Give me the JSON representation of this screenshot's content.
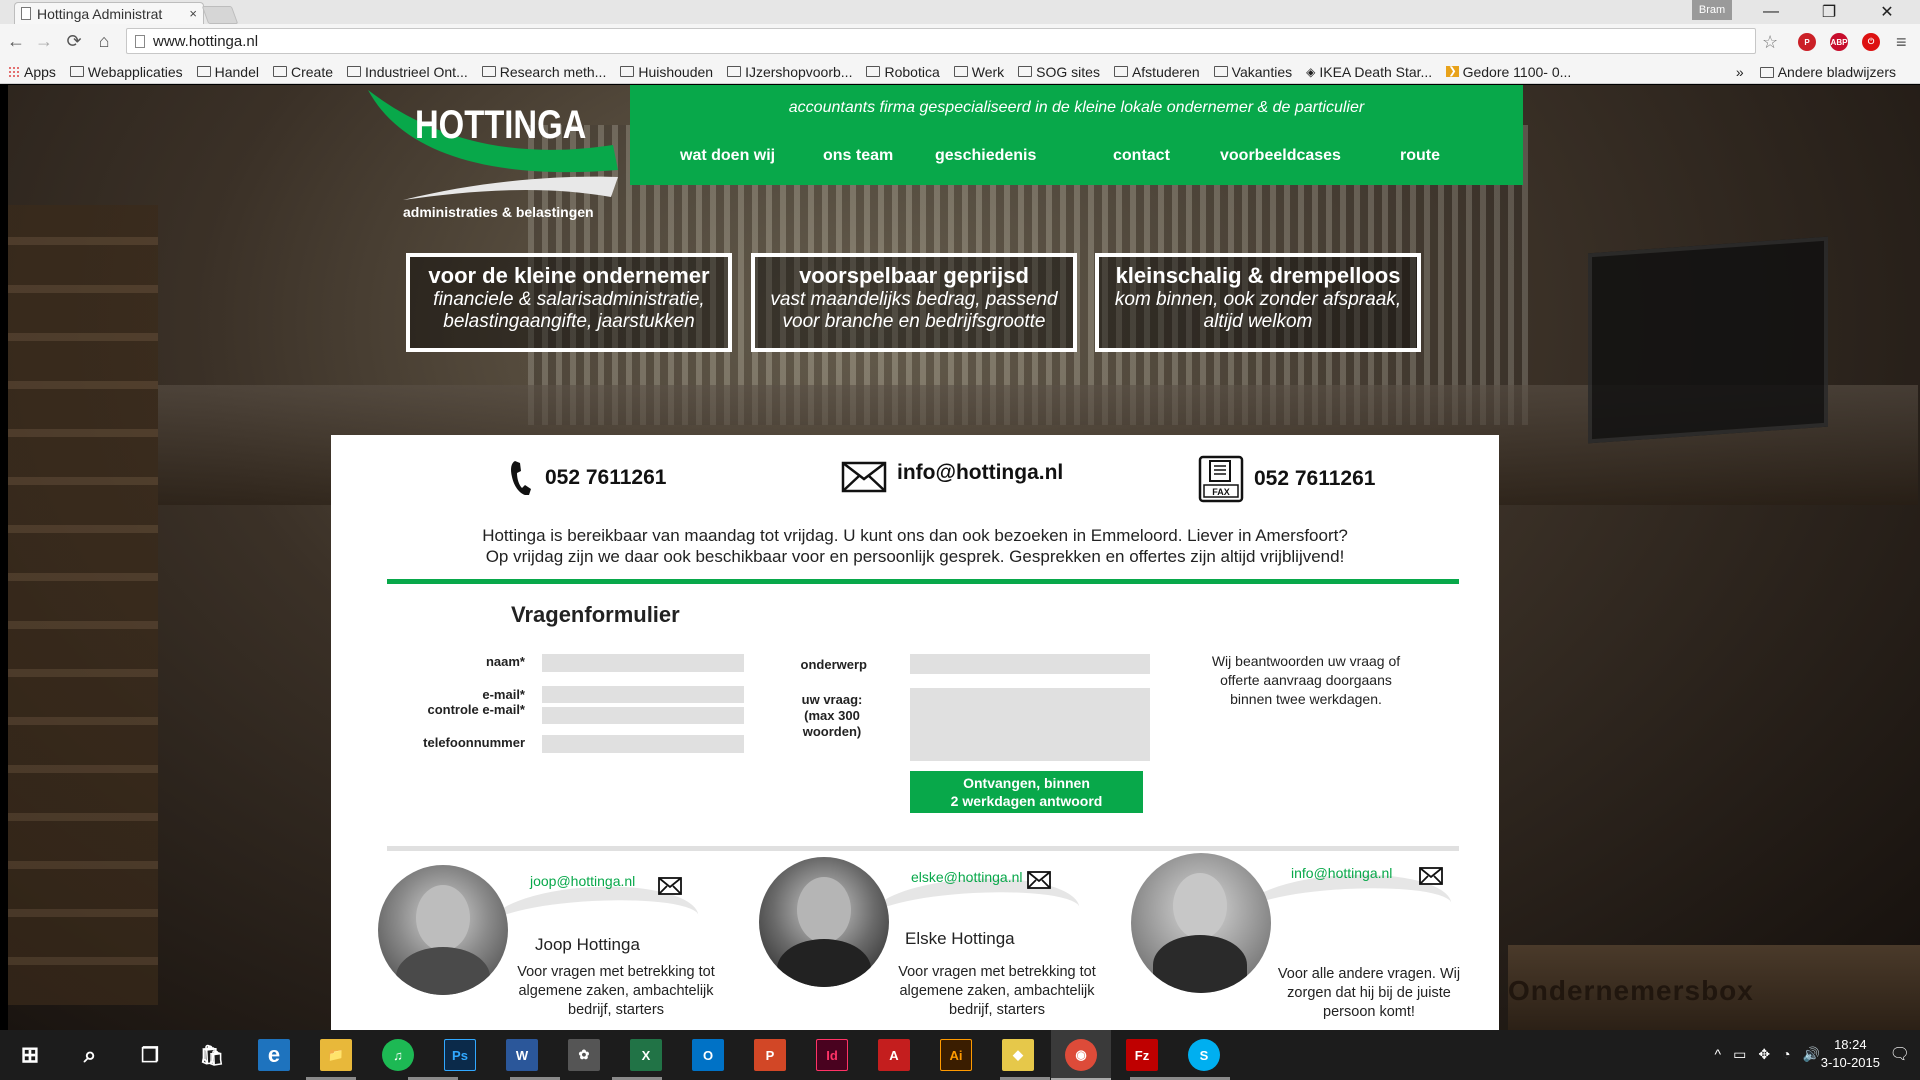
{
  "browser": {
    "tab_title": "Hottinga Administrat",
    "tab_close": "×",
    "profile": "Bram",
    "url": "www.hottinga.nl",
    "window_buttons": {
      "minimize": "—",
      "restore": "❐",
      "close": "✕"
    },
    "nav": {
      "back": "←",
      "forward": "→",
      "reload": "⟳",
      "home": "⌂"
    },
    "star": "☆",
    "menu": "≡",
    "extensions": [
      {
        "label": "P",
        "color": "#cb2027"
      },
      {
        "label": "ABP",
        "color": "#c70d2c"
      },
      {
        "label": "⏻",
        "color": "#d11"
      }
    ]
  },
  "bookmarks": {
    "items": [
      {
        "label": "Apps",
        "icon": "apps-grid-icon"
      },
      {
        "label": "Webapplicaties",
        "icon": "folder-icon"
      },
      {
        "label": "Handel",
        "icon": "folder-icon"
      },
      {
        "label": "Create",
        "icon": "folder-icon"
      },
      {
        "label": "Industrieel Ont...",
        "icon": "folder-icon"
      },
      {
        "label": "Research meth...",
        "icon": "folder-icon"
      },
      {
        "label": "Huishouden",
        "icon": "folder-icon"
      },
      {
        "label": "IJzershopvoorb...",
        "icon": "folder-icon"
      },
      {
        "label": "Robotica",
        "icon": "folder-icon"
      },
      {
        "label": "Werk",
        "icon": "folder-icon"
      },
      {
        "label": "SOG sites",
        "icon": "folder-icon"
      },
      {
        "label": "Afstuderen",
        "icon": "folder-icon"
      },
      {
        "label": "Vakanties",
        "icon": "folder-icon"
      },
      {
        "label": "IKEA Death Star...",
        "icon": "site-icon"
      },
      {
        "label": "Gedore 1100- 0...",
        "icon": "site-icon"
      }
    ],
    "overflow": "»",
    "other": "Andere bladwijzers"
  },
  "site": {
    "logo": {
      "name": "HOTTINGA",
      "subtitle": "administraties & belastingen"
    },
    "tagline": "accountants firma gespecialiseerd in de kleine lokale ondernemer & de particulier",
    "nav": [
      "wat doen wij",
      "ons team",
      "geschiedenis",
      "contact",
      "voorbeeldcases",
      "route"
    ],
    "features": [
      {
        "title": "voor de kleine ondernemer",
        "text": "financiele & salarisadministratie, belastingaangifte, jaarstukken"
      },
      {
        "title": "voorspelbaar geprijsd",
        "text": "vast maandelijks bedrag, passend voor branche en bedrijfsgrootte"
      },
      {
        "title": "kleinschalig & drempelloos",
        "text": "kom binnen, ook zonder afspraak, altijd welkom"
      }
    ],
    "contact": {
      "phone": "052 7611261",
      "email": "info@hottinga.nl",
      "fax": "052 7611261",
      "fax_label": "FAX"
    },
    "info_line1": "Hottinga is bereikbaar van maandag tot vrijdag. U kunt ons dan ook bezoeken in Emmeloord. Liever in Amersfoort?",
    "info_line2": "Op vrijdag zijn we daar ook beschikbaar voor en persoonlijk gesprek. Gesprekken en offertes zijn altijd vrijblijvend!",
    "form": {
      "title": "Vragenformulier",
      "naam": "naam*",
      "email": "e-mail*",
      "controle_email": "controle e-mail*",
      "telefoon": "telefoonnummer",
      "onderwerp": "onderwerp",
      "vraag_1": "uw vraag:",
      "vraag_2": "(max 300",
      "vraag_3": "woorden)",
      "submit_1": "Ontvangen, binnen",
      "submit_2": "2 werkdagen antwoord",
      "reply_note": "Wij beantwoorden uw vraag of offerte aanvraag doorgaans binnen twee werkdagen."
    },
    "team": [
      {
        "email": "joop@hottinga.nl",
        "name": "Joop Hottinga",
        "desc": "Voor vragen met betrekking tot algemene zaken, ambachtelijk bedrijf, starters"
      },
      {
        "email": "elske@hottinga.nl",
        "name": "Elske Hottinga",
        "desc": "Voor vragen met betrekking tot algemene zaken, ambachtelijk bedrijf, starters"
      },
      {
        "email": "info@hottinga.nl",
        "name": "",
        "desc": "Voor alle andere vragen. Wij zorgen dat hij bij de juiste persoon komt!"
      }
    ],
    "background_text": "Ondernemersbox"
  },
  "taskbar": {
    "apps": [
      {
        "name": "start",
        "label": "⊞",
        "color": "transparent"
      },
      {
        "name": "search",
        "label": "⌕",
        "color": "transparent"
      },
      {
        "name": "task-view",
        "label": "❐",
        "color": "transparent"
      },
      {
        "name": "store",
        "label": "🛍",
        "color": "transparent"
      },
      {
        "name": "edge",
        "label": "e",
        "color": "#1e73be"
      },
      {
        "name": "file-explorer",
        "label": "📁",
        "color": "#e8b83a"
      },
      {
        "name": "spotify",
        "label": "♫",
        "color": "#1db954"
      },
      {
        "name": "photoshop",
        "label": "Ps",
        "color": "#0b2a4a"
      },
      {
        "name": "word",
        "label": "W",
        "color": "#2b579a"
      },
      {
        "name": "app-9",
        "label": "✿",
        "color": "#555"
      },
      {
        "name": "excel",
        "label": "X",
        "color": "#217346"
      },
      {
        "name": "outlook",
        "label": "O",
        "color": "#0072c6"
      },
      {
        "name": "powerpoint",
        "label": "P",
        "color": "#d24726"
      },
      {
        "name": "indesign",
        "label": "Id",
        "color": "#49021f"
      },
      {
        "name": "acrobat",
        "label": "A",
        "color": "#c41e1e"
      },
      {
        "name": "illustrator",
        "label": "Ai",
        "color": "#3a1d00"
      },
      {
        "name": "app-17",
        "label": "◆",
        "color": "#e6c84a"
      },
      {
        "name": "chrome",
        "label": "◉",
        "color": "#dd4b39"
      },
      {
        "name": "filezilla",
        "label": "Fz",
        "color": "#bf0000"
      },
      {
        "name": "skype",
        "label": "S",
        "color": "#00aff0"
      }
    ],
    "tray": [
      "^",
      "▭",
      "✥",
      "◔",
      "🔊"
    ],
    "time": "18:24",
    "date": "3-10-2015",
    "notification": "🗨"
  }
}
